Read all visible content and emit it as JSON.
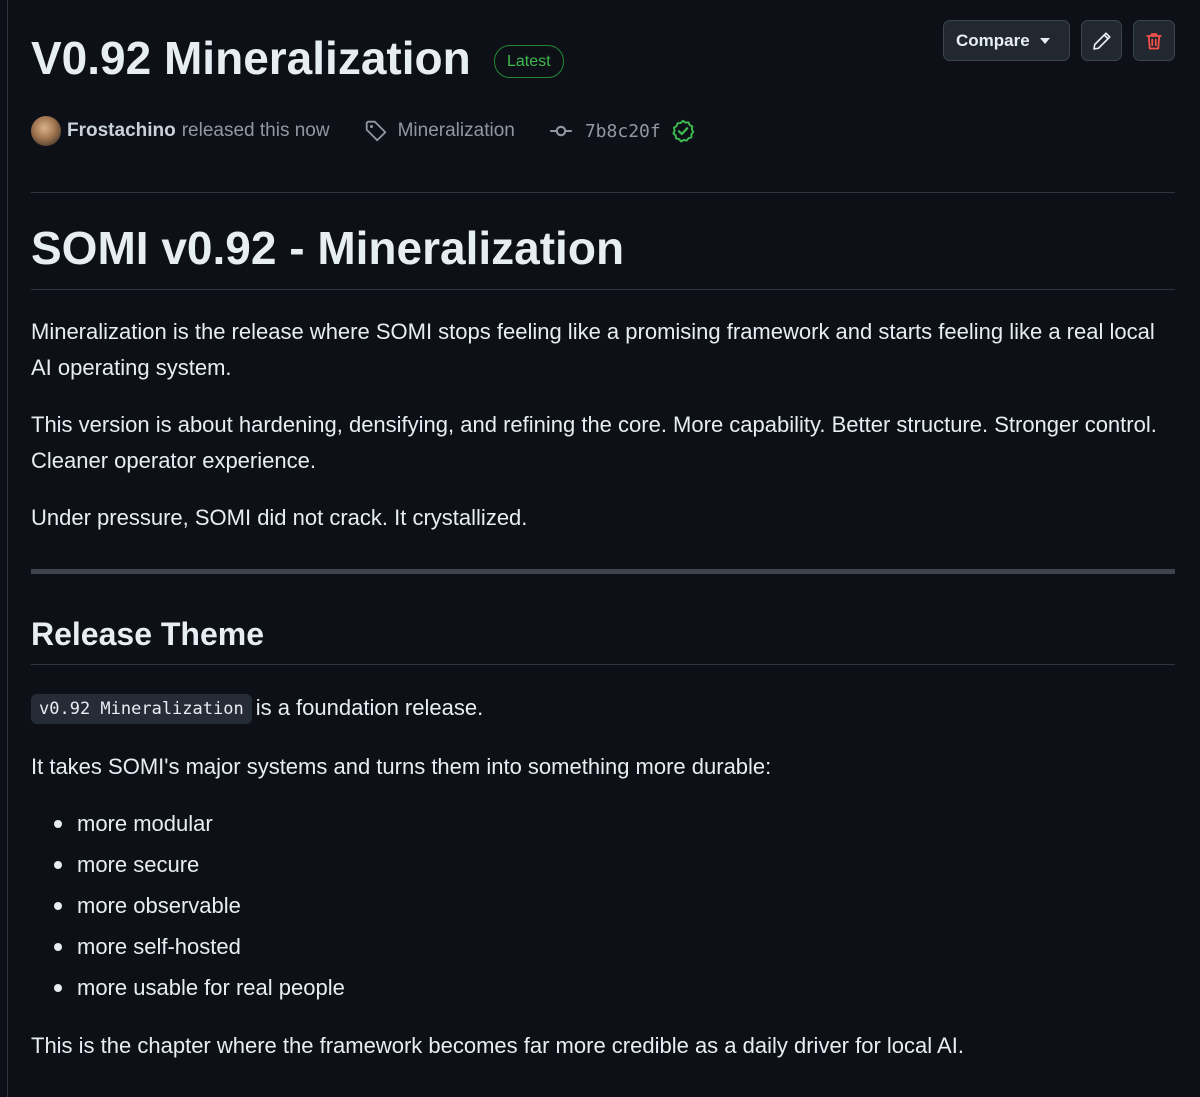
{
  "header": {
    "title": "V0.92 Mineralization",
    "badge": "Latest",
    "compare_label": "Compare"
  },
  "meta": {
    "author": "Frostachino",
    "released_text": "released this now",
    "tag": "Mineralization",
    "commit_sha": "7b8c20f"
  },
  "body": {
    "heading": "SOMI v0.92 - Mineralization",
    "paragraphs": [
      "Mineralization is the release where SOMI stops feeling like a promising framework and starts feeling like a real local AI operating system.",
      "This version is about hardening, densifying, and refining the core. More capability. Better structure. Stronger control. Cleaner operator experience.",
      "Under pressure, SOMI did not crack. It crystallized."
    ],
    "section_heading": "Release Theme",
    "code_snippet": "v0.92 Mineralization",
    "code_suffix": "is a foundation release.",
    "intro_list": "It takes SOMI's major systems and turns them into something more durable:",
    "list_items": [
      "more modular",
      "more secure",
      "more observable",
      "more self-hosted",
      "more usable for real people"
    ],
    "closing": "This is the chapter where the framework becomes far more credible as a daily driver for local AI."
  },
  "icons": {
    "edit": "pencil-icon",
    "delete": "trash-icon",
    "tag": "tag-icon",
    "commit": "git-commit-icon",
    "verified": "verified-check-icon"
  },
  "colors": {
    "background": "#0d1117",
    "text": "#e6edf3",
    "muted": "#9198a1",
    "success": "#3fb950",
    "danger": "#f85149"
  }
}
